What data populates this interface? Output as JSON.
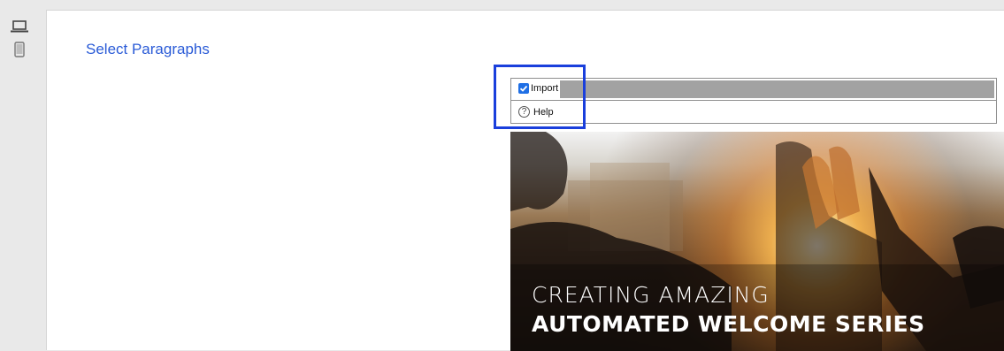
{
  "sidebar": {
    "devices": [
      {
        "name": "desktop-view",
        "icon": "laptop-icon"
      },
      {
        "name": "mobile-view",
        "icon": "phone-icon"
      }
    ]
  },
  "main": {
    "page_link": "Select Paragraphs"
  },
  "toolbar": {
    "import_label": "Import",
    "import_checked": true,
    "help_label": "Help",
    "help_icon": "question-circle-icon"
  },
  "hero": {
    "line1": "CREATING AMAZING",
    "line2": "AUTOMATED WELCOME SERIES"
  },
  "colors": {
    "link": "#2a5bd7",
    "highlight": "#1a3fdc",
    "checkbox": "#1f6fe5"
  }
}
